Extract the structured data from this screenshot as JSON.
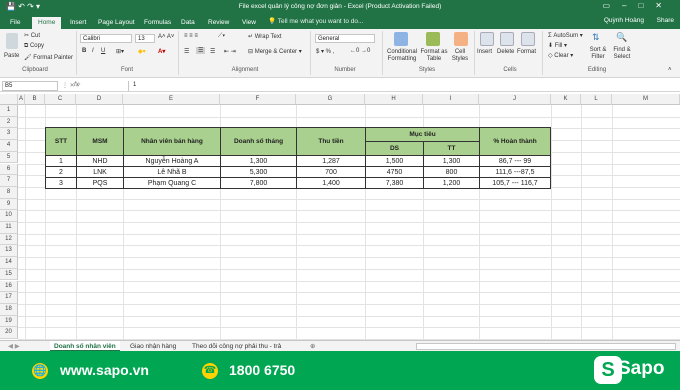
{
  "window": {
    "title": "File excel quản lý công nợ đơn giản - Excel (Product Activation Failed)"
  },
  "tabs": [
    "File",
    "Home",
    "Insert",
    "Page Layout",
    "Formulas",
    "Data",
    "Review",
    "View"
  ],
  "tellme": "Tell me what you want to do...",
  "user": "Quỳnh Hoàng",
  "share": "Share",
  "ribbon": {
    "clipboard": {
      "label": "Clipboard",
      "paste": "Paste",
      "cut": "Cut",
      "copy": "Copy",
      "format_painter": "Format Painter"
    },
    "font": {
      "label": "Font",
      "name": "Calibri",
      "size": "13"
    },
    "alignment": {
      "label": "Alignment",
      "wrap": "Wrap Text",
      "merge": "Merge & Center"
    },
    "number": {
      "label": "Number",
      "format": "General"
    },
    "styles": {
      "label": "Styles",
      "conditional": "Conditional Formatting",
      "format_table": "Format as Table",
      "cell_styles": "Cell Styles"
    },
    "cells": {
      "label": "Cells",
      "insert": "Insert",
      "delete": "Delete",
      "format": "Format"
    },
    "editing": {
      "label": "Editing",
      "autosum": "AutoSum",
      "fill": "Fill",
      "clear": "Clear",
      "sort": "Sort & Filter",
      "find": "Find & Select"
    }
  },
  "formula_bar": {
    "name_box": "B5",
    "fx": "fx",
    "value": "1"
  },
  "columns": [
    "A",
    "B",
    "C",
    "D",
    "E",
    "F",
    "G",
    "H",
    "I",
    "J",
    "K",
    "L",
    "M"
  ],
  "rows": [
    "1",
    "2",
    "3",
    "4",
    "5",
    "6",
    "7",
    "8",
    "9",
    "10",
    "11",
    "12",
    "13",
    "14",
    "15",
    "16",
    "17",
    "18",
    "19",
    "20"
  ],
  "table": {
    "headers": {
      "stt": "STT",
      "msm": "MSM",
      "nv": "Nhân viên bán hàng",
      "ds": "Doanh số tháng",
      "thu": "Thu tiền",
      "muctieu": "Mục tiêu",
      "ds2": "DS",
      "tt": "TT",
      "pct": "% Hoàn thành"
    },
    "rows": [
      {
        "stt": "1",
        "msm": "NHD",
        "nv": "Nguyễn Hoàng A",
        "ds": "1,300",
        "thu": "1,287",
        "mds": "1,500",
        "mtt": "1,300",
        "pct": "86,7 --- 99"
      },
      {
        "stt": "2",
        "msm": "LNK",
        "nv": "Lê Nhã B",
        "ds": "5,300",
        "thu": "700",
        "mds": "4750",
        "mtt": "800",
        "pct": "111,6 ---87,5"
      },
      {
        "stt": "3",
        "msm": "PQS",
        "nv": "Phạm Quang C",
        "ds": "7,800",
        "thu": "1,400",
        "mds": "7,380",
        "mtt": "1,200",
        "pct": "105,7 --- 116,7"
      }
    ]
  },
  "sheet_tabs": [
    "Doanh số nhân viên",
    "Giao nhận hàng",
    "Theo dõi công nợ phải thu - trả"
  ],
  "banner": {
    "website": "www.sapo.vn",
    "phone": "1800 6750",
    "brand": "Sapo",
    "accent": "#00a651"
  }
}
